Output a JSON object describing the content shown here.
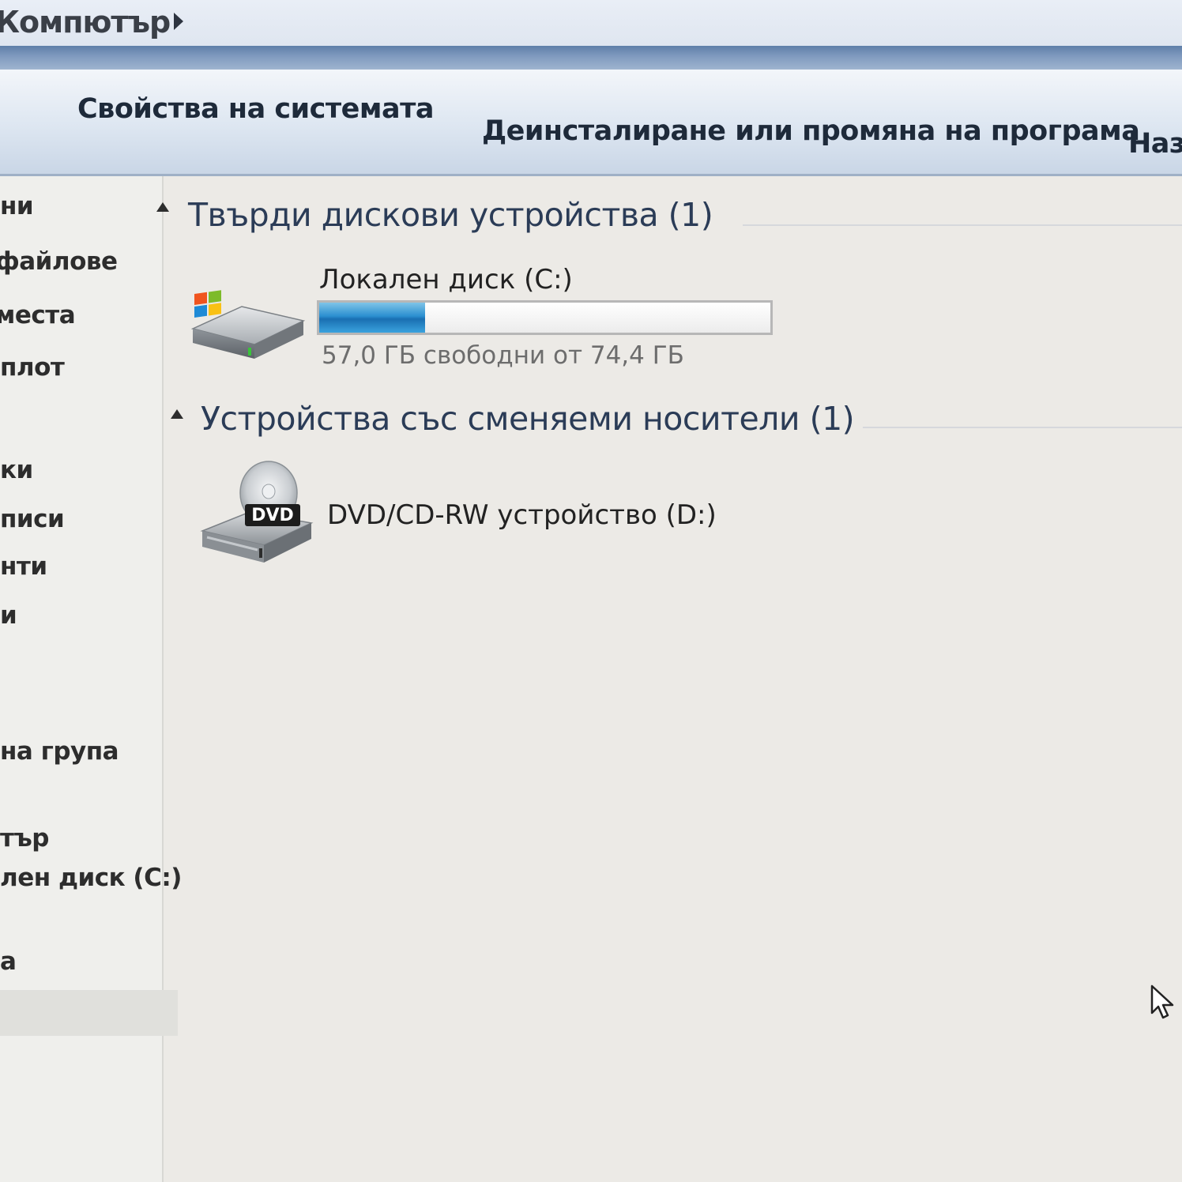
{
  "address_bar": {
    "breadcrumb": "Компютър"
  },
  "toolbar": {
    "system_properties": "Свойства на системата",
    "uninstall_program": "Деинсталиране или промяна на програма",
    "cut_off_item": "Наз"
  },
  "nav_pane": {
    "items": [
      "ни",
      "файлове",
      "места",
      "плот",
      "ки",
      "писи",
      "нти",
      "и",
      "на група",
      "тър",
      "лен диск (C:)",
      "а"
    ]
  },
  "content": {
    "hard_disks": {
      "header": "Твърди дискови устройства (1)",
      "drive": {
        "name": "Локален диск (C:)",
        "free_text": "57,0 ГБ свободни от 74,4 ГБ",
        "used_fraction": 0.234
      }
    },
    "removable": {
      "header": "Устройства със сменяеми носители (1)",
      "drive": {
        "name": "DVD/CD-RW устройство (D:)",
        "icon_label": "DVD"
      }
    }
  },
  "icons": {
    "hdd": "hard-drive-windows-icon",
    "dvd": "dvd-drive-icon",
    "cursor": "mouse-pointer-icon"
  },
  "colors": {
    "accent_band": "#7d98bd",
    "progress_fill": "#2b8fd0",
    "group_header": "#2b3c57"
  }
}
